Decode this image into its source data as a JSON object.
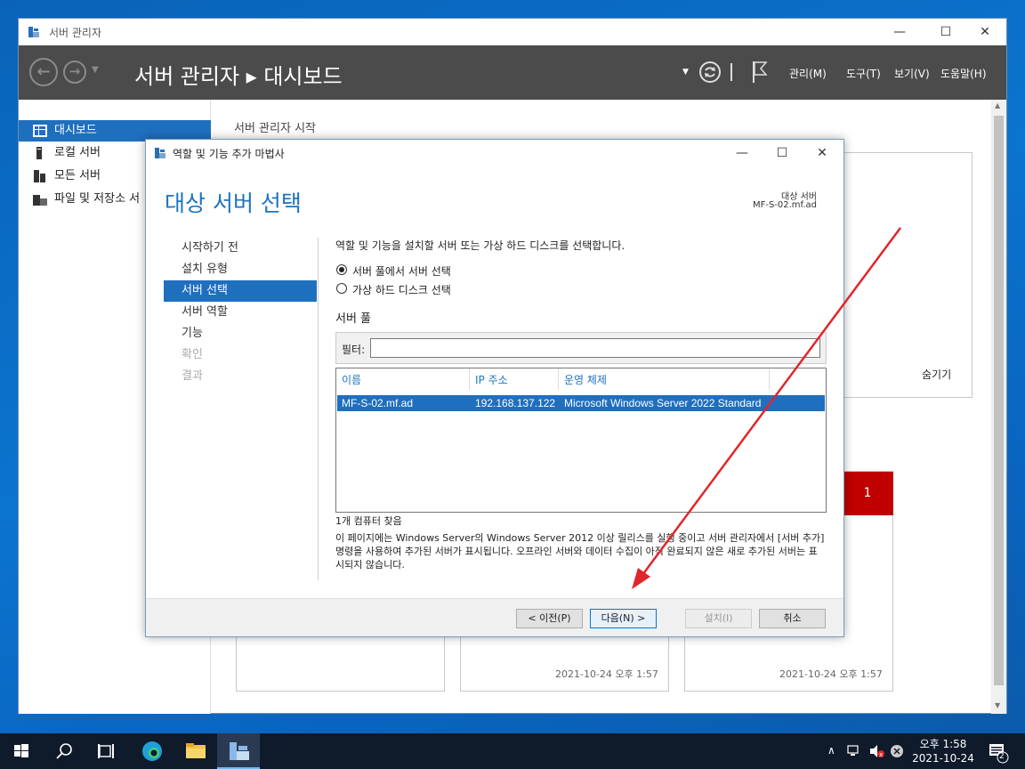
{
  "sm": {
    "title": "서버 관리자",
    "breadcrumb": "서버 관리자 ▸ 대시보드",
    "menus": [
      "관리(M)",
      "도구(T)",
      "보기(V)",
      "도움말(H)"
    ],
    "nav": [
      "대시보드",
      "로컬 서버",
      "모든 서버",
      "파일 및 저장소 서"
    ],
    "main_heading": "서버 관리자 시작",
    "hide_link": "숨기기",
    "badge_count": "1",
    "tile_times": [
      "2021-10-24 오후 1:57",
      "2021-10-24 오후 1:57"
    ]
  },
  "wizard": {
    "title": "역할 및 기능 추가 마법사",
    "heading": "대상 서버 선택",
    "dest_label": "대상 서버",
    "dest_value": "MF-S-02.mf.ad",
    "steps": [
      "시작하기 전",
      "설치 유형",
      "서버 선택",
      "서버 역할",
      "기능",
      "확인",
      "결과"
    ],
    "instruction": "역할 및 기능을 설치할 서버 또는 가상 하드 디스크를 선택합니다.",
    "radio_pool": "서버 풀에서 서버 선택",
    "radio_vhd": "가상 하드 디스크 선택",
    "pool_label": "서버 풀",
    "filter_label": "필터:",
    "filter_value": "",
    "columns": [
      "이름",
      "IP 주소",
      "운영 체제"
    ],
    "rows": [
      {
        "name": "MF-S-02.mf.ad",
        "ip": "192.168.137.122",
        "os": "Microsoft Windows Server 2022 Standard"
      }
    ],
    "found": "1개 컴퓨터 찾음",
    "note": "이 페이지에는 Windows Server의 Windows Server 2012 이상 릴리스를 실행 중이고 서버 관리자에서 [서버 추가] 명령을 사용하여 추가된 서버가 표시됩니다. 오프라인 서버와 데이터 수집이 아직 완료되지 않은 새로 추가된 서버는 표시되지 않습니다.",
    "buttons": {
      "prev": "< 이전(P)",
      "next": "다음(N) >",
      "install": "설치(I)",
      "cancel": "취소"
    }
  },
  "taskbar": {
    "time": "오후 1:58",
    "date": "2021-10-24",
    "notif_count": "2"
  },
  "colors": {
    "accent": "#1f6fbf",
    "header": "#4b4b4b",
    "badge": "#c00000",
    "arrow": "#e0262b"
  }
}
